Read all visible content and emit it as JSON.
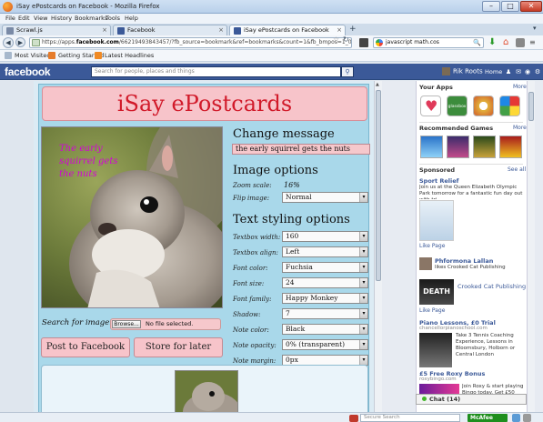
{
  "window": {
    "title": "iSay ePostcards on Facebook - Mozilla Firefox",
    "minimize": "–",
    "maximize": "□",
    "close": "✕"
  },
  "menu": [
    "File",
    "Edit",
    "View",
    "History",
    "Bookmarks",
    "Tools",
    "Help"
  ],
  "tabs": [
    {
      "label": "Scrawl.js",
      "active": false
    },
    {
      "label": "Facebook",
      "active": false
    },
    {
      "label": "iSay ePostcards on Facebook",
      "active": true
    }
  ],
  "nav": {
    "url_scheme": "https://apps.",
    "url_host": "facebook.com",
    "url_rest": "/66219493843457/?fb_source=bookmark&ref=bookmarks&count=1&fb_bmpos=1_0",
    "search_value": "javascript math.cos"
  },
  "bookmarks": [
    "Most Visited",
    "Getting Started",
    "Latest Headlines"
  ],
  "fb": {
    "logo": "facebook",
    "search_placeholder": "Search for people, places and things",
    "user": "Rik Roots",
    "home": "Home"
  },
  "app": {
    "title": "iSay ePostcards",
    "caption": "The early squirrel gets the nuts",
    "change_message_heading": "Change message",
    "message_value": "the early squirrel gets the nuts",
    "image_options_heading": "Image options",
    "zoom_label": "Zoom scale:",
    "zoom_value": "16%",
    "flip_label": "Flip image:",
    "flip_value": "Normal",
    "text_styling_heading": "Text styling options",
    "textbox_width_label": "Textbox width:",
    "textbox_width_value": "160",
    "textbox_align_label": "Textbox align:",
    "textbox_align_value": "Left",
    "font_color_label": "Font color:",
    "font_color_value": "Fuchsia",
    "font_size_label": "Font size:",
    "font_size_value": "24",
    "font_family_label": "Font family:",
    "font_family_value": "Happy Monkey",
    "shadow_label": "Shadow:",
    "shadow_value": "7",
    "note_color_label": "Note color:",
    "note_color_value": "Black",
    "note_opacity_label": "Note opacity:",
    "note_opacity_value": "0% (transparent)",
    "note_margin_label": "Note margin:",
    "note_margin_value": "0px",
    "search_image_label": "Search for image:",
    "browse_label": "Browse...",
    "no_file_label": "No file selected.",
    "post_button": "Post to Facebook",
    "store_button": "Store for later"
  },
  "sidebar": {
    "your_apps": "Your Apps",
    "apps_more": "More",
    "app2": "glassbox",
    "recommended_games": "Recommended Games",
    "games_more": "More",
    "sponsored": "Sponsored",
    "see_all": "See all",
    "ads": [
      {
        "title": "Sport Relief",
        "text": "Join us at the Queen Elizabeth Olympic Park tomorrow for a fantastic fun day out with tri…",
        "meta": "Like Page"
      },
      {
        "title": "Phformona Lallan",
        "text": "likes Crooked Cat Publishing",
        "sub": "Crooked Cat Publishing",
        "meta": "Like Page"
      },
      {
        "title": "Piano Lessons, £0 Trial",
        "url": "chancellorpianoschool.com",
        "text": "Take 3 Tennis Coaching Experience, Lessons in Bloomsbury, Holborn or Central London"
      },
      {
        "title": "£5 Free Roxy Bonus",
        "url": "roxybingo.com",
        "text": "Join Roxy & start playing Bingo today. Get £50 FREE"
      }
    ],
    "chat": "Chat (14)"
  },
  "status": {
    "secure_search_placeholder": "Secure Search",
    "mcafee": "McAfee"
  },
  "colors": {
    "facebook_blue": "#3b5998",
    "title_red": "#d11a2a",
    "caption_fuchsia": "#d400d8",
    "panel_blue": "#a9d8ea",
    "pink": "#f7c4ca"
  }
}
